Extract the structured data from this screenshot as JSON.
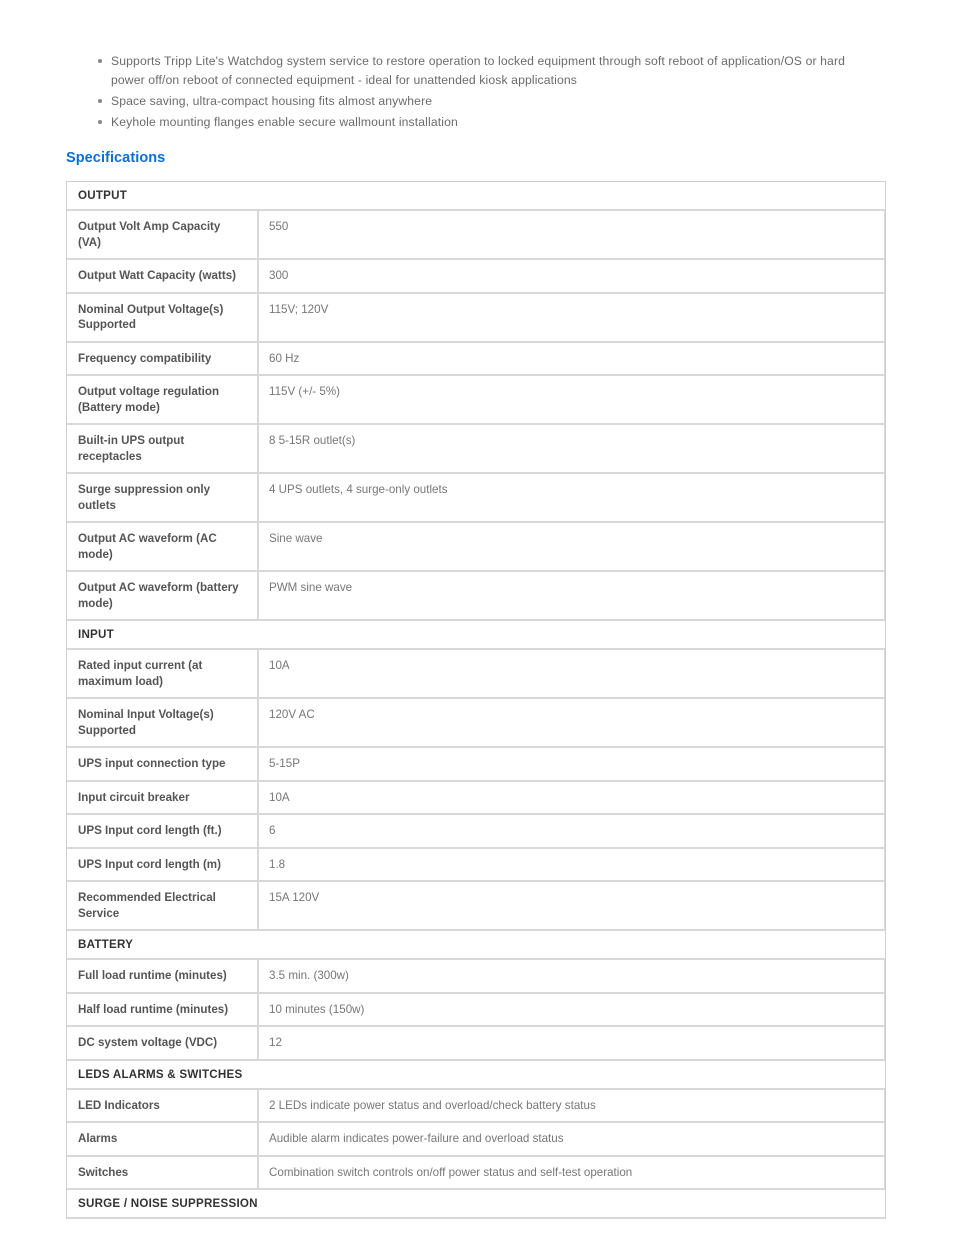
{
  "features": [
    "Supports Tripp Lite's Watchdog system service to restore operation to locked equipment through soft reboot of application/OS or hard power off/on reboot of connected equipment - ideal for unattended kiosk applications",
    "Space saving, ultra-compact housing fits almost anywhere",
    "Keyhole mounting flanges enable secure wallmount installation"
  ],
  "specifications": {
    "heading": "Specifications",
    "heading_color": "#0d6fd1",
    "groups": [
      {
        "title": "OUTPUT",
        "rows": [
          {
            "label": "Output Volt Amp Capacity (VA)",
            "value": "550",
            "lines": 2
          },
          {
            "label": "Output Watt Capacity (watts)",
            "value": "300",
            "lines": 1
          },
          {
            "label": "Nominal Output Voltage(s) Supported",
            "value": "115V; 120V",
            "lines": 2
          },
          {
            "label": "Frequency compatibility",
            "value": "60 Hz",
            "lines": 1
          },
          {
            "label": "Output voltage regulation (Battery mode)",
            "value": "115V (+/- 5%)",
            "lines": 2
          },
          {
            "label": "Built-in UPS output receptacles",
            "value": "8 5-15R outlet(s)",
            "lines": 2
          },
          {
            "label": "Surge suppression only outlets",
            "value": "4 UPS outlets, 4 surge-only outlets",
            "lines": 2
          },
          {
            "label": "Output AC waveform (AC mode)",
            "value": "Sine wave",
            "lines": 2
          },
          {
            "label": "Output AC waveform (battery mode)",
            "value": "PWM sine wave",
            "lines": 2
          }
        ]
      },
      {
        "title": "INPUT",
        "rows": [
          {
            "label": "Rated input current (at maximum load)",
            "value": "10A",
            "lines": 2
          },
          {
            "label": "Nominal Input Voltage(s) Supported",
            "value": "120V AC",
            "lines": 2
          },
          {
            "label": "UPS input connection type",
            "value": "5-15P",
            "lines": 1
          },
          {
            "label": "Input circuit breaker",
            "value": "10A",
            "lines": 1
          },
          {
            "label": "UPS Input cord length (ft.)",
            "value": "6",
            "lines": 1
          },
          {
            "label": "UPS Input cord length (m)",
            "value": "1.8",
            "lines": 1
          },
          {
            "label": "Recommended Electrical Service",
            "value": "15A 120V",
            "lines": 2
          }
        ]
      },
      {
        "title": "BATTERY",
        "rows": [
          {
            "label": "Full load runtime (minutes)",
            "value": "3.5 min. (300w)",
            "lines": 1
          },
          {
            "label": "Half load runtime (minutes)",
            "value": "10 minutes (150w)",
            "lines": 1
          },
          {
            "label": "DC system voltage (VDC)",
            "value": "12",
            "lines": 1
          }
        ]
      },
      {
        "title": "LEDS ALARMS & SWITCHES",
        "rows": [
          {
            "label": "LED Indicators",
            "value": "2 LEDs indicate power status and overload/check battery status",
            "lines": 1
          },
          {
            "label": "Alarms",
            "value": "Audible alarm indicates power-failure and overload status",
            "lines": 1
          },
          {
            "label": "Switches",
            "value": "Combination switch controls on/off power status and self-test operation",
            "lines": 1
          }
        ]
      },
      {
        "title": "SURGE / NOISE SUPPRESSION",
        "rows": []
      }
    ]
  }
}
